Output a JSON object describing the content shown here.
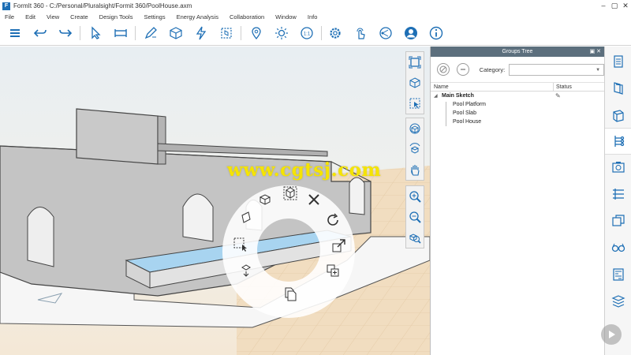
{
  "window": {
    "title": "FormIt 360 - C:/Personal/Pluralsight/Formit 360/PoolHouse.axm",
    "logo_letter": "F",
    "controls": [
      "–",
      "▢",
      "✕"
    ]
  },
  "menu": [
    "File",
    "Edit",
    "View",
    "Create",
    "Design Tools",
    "Settings",
    "Energy Analysis",
    "Collaboration",
    "Window",
    "Info"
  ],
  "groups_panel": {
    "title": "Groups Tree",
    "category_label": "Category:",
    "category_value": "",
    "columns": {
      "name": "Name",
      "status": "Status"
    },
    "root": "Main Sketch",
    "children": [
      "Pool Platform",
      "Pool Slab",
      "Pool House"
    ]
  },
  "watermark": "www.cgtsj.com",
  "colors": {
    "accent": "#1e6fb5",
    "panel_header": "#5c6f7d",
    "pool_water": "#a8d4f0",
    "yellow_watermark": "#f5e400"
  },
  "toolbar_icons": [
    "menu-icon",
    "undo-icon",
    "redo-icon",
    "select-icon",
    "measure-icon",
    "sketch-icon",
    "cube-icon",
    "lightning-icon",
    "group-icon",
    "location-icon",
    "sun-icon",
    "scale-icon",
    "gear-icon",
    "touch-icon",
    "share-icon",
    "user-icon",
    "info-icon"
  ]
}
